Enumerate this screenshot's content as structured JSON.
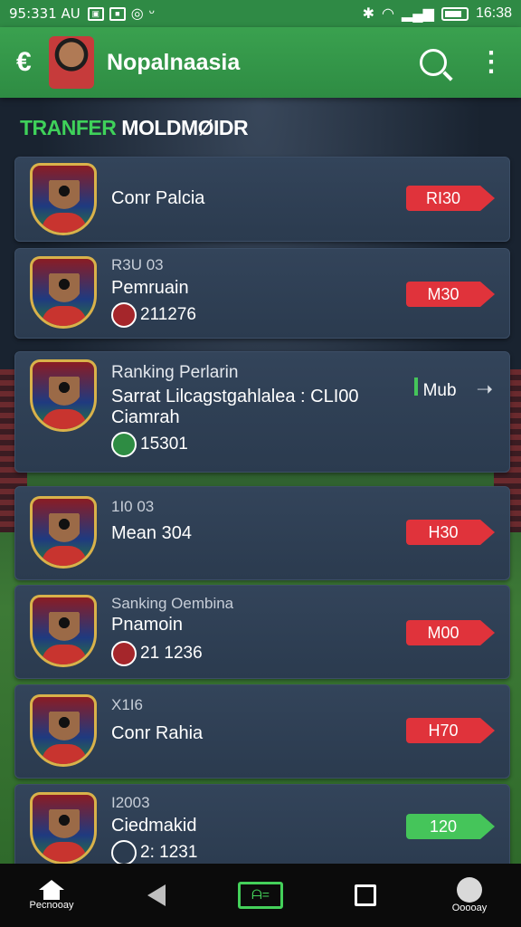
{
  "status_bar": {
    "time": "95:331 AU",
    "right_time": "16:38",
    "icons": [
      "image-icon",
      "box-icon",
      "circle-icon",
      "bluetooth-icon",
      "wifi-icon",
      "signal-icon",
      "battery-icon"
    ]
  },
  "app_bar": {
    "title": "Nopalnaasia",
    "back_glyph": "€",
    "menu_glyph": "⋮"
  },
  "section": {
    "title_green": "TRANFER",
    "title_white": " MOLDMØIDR"
  },
  "players": [
    {
      "small": "",
      "name": "Conr Palcia",
      "stat": "",
      "price": "RI30",
      "price_color": "red"
    },
    {
      "small": "R3U 03",
      "name": "Pemruain",
      "stat": "211276",
      "price": "M30",
      "price_color": "red"
    },
    {
      "small": "Ranking Perlarin",
      "name": "Sarrat Lilcagstgahlalea : CLI00",
      "name2": "Ciamrah",
      "stat": "15301",
      "mub": "Mub",
      "mub_arrow": "➝"
    },
    {
      "small": "1I0 03",
      "name": "Mean 304",
      "stat": "",
      "price": "H30",
      "price_color": "red"
    },
    {
      "small": "Sanking Oembina",
      "name": "Pnamoin",
      "stat": "21 1236",
      "price": "M00",
      "price_color": "red"
    },
    {
      "small": "X1I6",
      "name": "Conr Rahia",
      "stat": "",
      "price": "H70",
      "price_color": "red"
    },
    {
      "small": "I2003",
      "name": "Ciedmakid",
      "stat": "2: 1231",
      "price": "120",
      "price_color": "green"
    }
  ],
  "nav": {
    "home_label": "Pecnooay",
    "profile_label": "Ooooay",
    "screen_glyph": "ᗩ="
  },
  "colors": {
    "primary_green": "#2f8a45",
    "accent_green": "#45c55a",
    "price_red": "#e0333b",
    "card_bg": "#2f4056"
  }
}
